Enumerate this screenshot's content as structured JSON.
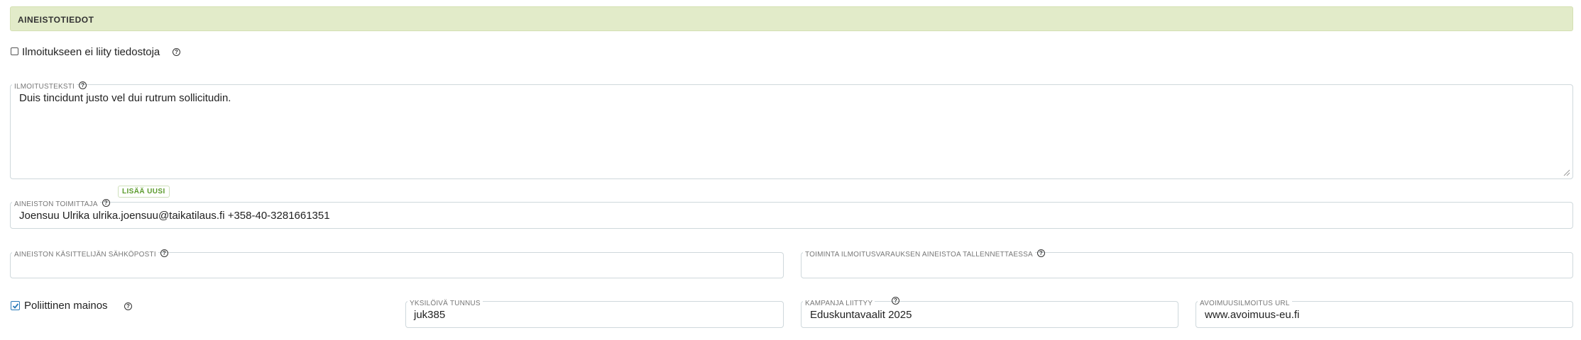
{
  "section": {
    "title": "AINEISTOTIEDOT"
  },
  "no_files": {
    "label": "Ilmoitukseen ei liity tiedostoja",
    "checked": false
  },
  "ad_text": {
    "label": "ILMOITUSTEKSTI",
    "value": "Duis tincidunt justo vel dui rutrum sollicitudin."
  },
  "supplier": {
    "label": "AINEISTON TOIMITTAJA",
    "add_new_label": "LISÄÄ UUSI",
    "value": "Joensuu Ulrika ulrika.joensuu@taikatilaus.fi +358-40-3281661351"
  },
  "handler_email": {
    "label": "AINEISTON KÄSITTELIJÄN SÄHKÖPOSTI",
    "value": ""
  },
  "save_action": {
    "label": "TOIMINTA ILMOITUSVARAUKSEN AINEISTOA TALLENNETTAESSA",
    "value": ""
  },
  "political_ad": {
    "label": "Poliittinen mainos",
    "checked": true
  },
  "unique_id": {
    "label": "YKSILÖIVÄ TUNNUS",
    "value": "juk385"
  },
  "campaign": {
    "label": "KAMPANJA LIITTYY",
    "value": "Eduskuntavaalit 2025"
  },
  "transparency_url": {
    "label": "AVOIMUUSILMOITUS URL",
    "value": "www.avoimuus-eu.fi"
  },
  "help_icon_glyph": "?",
  "colors": {
    "header_bg": "#e2ebc9",
    "checkbox_accent": "#2a7ab8",
    "badge_text": "#5a9a2a"
  }
}
